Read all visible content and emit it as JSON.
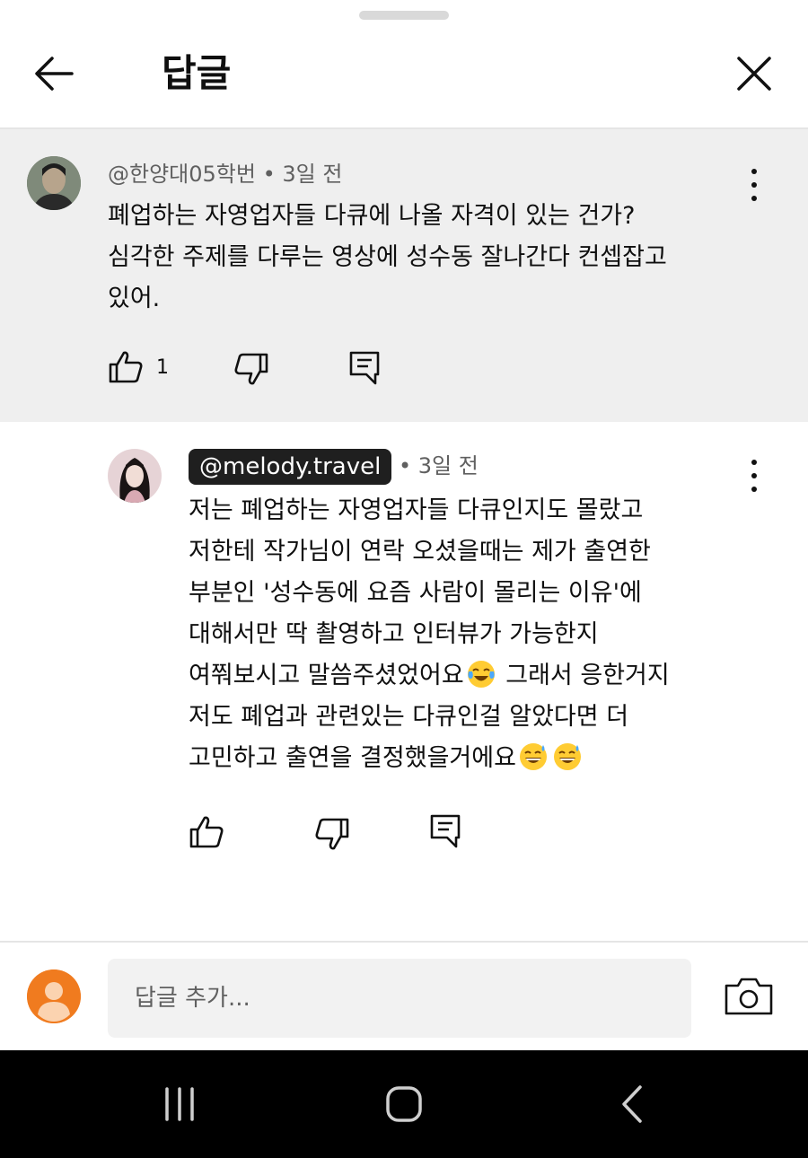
{
  "header": {
    "title": "답글"
  },
  "parent_comment": {
    "author": "@한양대05학번",
    "time": "3일 전",
    "lines": [
      "폐업하는 자영업자들 다큐에 나올 자격이 있는 건가?",
      "심각한 주제를 다루는 영상에 성수동 잘나간다 컨셉잡고",
      "있어."
    ],
    "like_count": "1"
  },
  "reply": {
    "author": "@melody.travel",
    "time": "3일 전",
    "lines": [
      "저는 폐업하는 자영업자들 다큐인지도 몰랐고",
      "저한테 작가님이 연락 오셨을때는 제가 출연한",
      "부분인 '성수동에 요즘 사람이 몰리는 이유'에",
      "대해서만 딱 촬영하고 인터뷰가 가능한지",
      "여쭤보시고 말씀주셨었어요",
      " 그래서 응한거지",
      "저도 폐업과 관련있는 다큐인걸 알았다면 더",
      "고민하고 출연을 결정했을거에요"
    ]
  },
  "footer": {
    "reply_placeholder": "답글 추가..."
  },
  "icons": {
    "back": "arrow-left-icon",
    "close": "close-icon",
    "more": "more-vertical-icon",
    "like": "thumbs-up-icon",
    "dislike": "thumbs-down-icon",
    "reply": "comment-icon",
    "camera": "camera-icon",
    "emoji_laugh": "tears-of-joy-emoji",
    "emoji_sweat": "grinning-sweat-emoji"
  },
  "colors": {
    "parent_background": "#efefef",
    "author_chip": "#1f1f1f",
    "default_avatar": "#f07b1f",
    "nav_bar": "#000000"
  }
}
